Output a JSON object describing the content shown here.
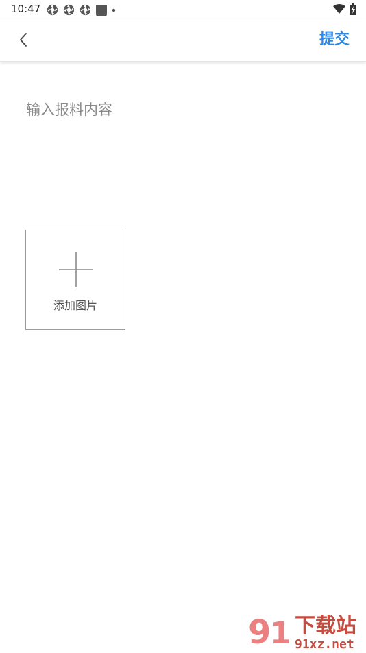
{
  "status_bar": {
    "time": "10:47",
    "notification_icons": [
      "aperture-icon",
      "aperture-icon",
      "aperture-icon",
      "square-icon",
      "dot-icon"
    ],
    "system_icons": [
      "wifi-icon",
      "battery-charging-icon"
    ]
  },
  "header": {
    "back_icon": "chevron-left-icon",
    "submit_label": "提交",
    "accent_color": "#2d8ae6"
  },
  "form": {
    "content_placeholder": "输入报料内容",
    "content_value": "",
    "add_image_label": "添加图片"
  },
  "watermark": {
    "logo_text": "91下载站",
    "url_text": "91xz.net"
  }
}
